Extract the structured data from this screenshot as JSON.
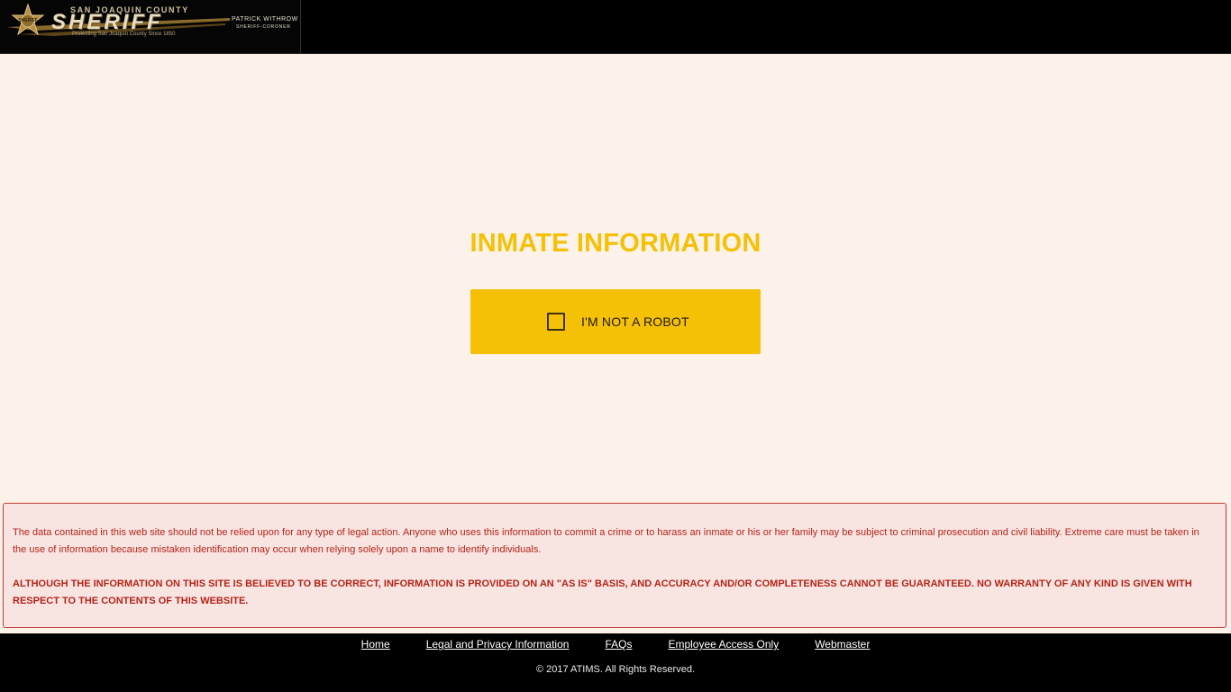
{
  "header": {
    "logo": {
      "county": "SAN JOAQUIN COUNTY",
      "department": "SHERIFF",
      "motto": "Protecting San Joaquin County Since 1850",
      "sheriff_name": "PATRICK WITHROW",
      "sheriff_title": "SHERIFF-CORONER",
      "star_text": "SHERIFF"
    }
  },
  "main": {
    "title": "INMATE INFORMATION",
    "captcha": {
      "label": "I'M NOT A ROBOT",
      "checked": false
    }
  },
  "disclaimer": {
    "paragraph1": "The data contained in this web site should not be relied upon for any type of legal action. Anyone who uses this information to commit a crime or to harass an inmate or his or her family may be subject to criminal prosecution and civil liability. Extreme care must be taken in the use of information because mistaken identification may occur when relying solely upon a name to identify individuals.",
    "paragraph2": "ALTHOUGH THE INFORMATION ON THIS SITE IS BELIEVED TO BE CORRECT, INFORMATION IS PROVIDED ON AN \"AS IS\" BASIS, AND ACCURACY AND/OR COMPLETENESS CANNOT BE GUARANTEED. NO WARRANTY OF ANY KIND IS GIVEN WITH RESPECT TO THE CONTENTS OF THIS WEBSITE."
  },
  "footer": {
    "links": {
      "home": "Home",
      "legal": "Legal and Privacy Information",
      "faqs": "FAQs",
      "employee": "Employee Access Only",
      "webmaster": "Webmaster"
    },
    "copyright": "© 2017 ATIMS. All Rights Reserved."
  },
  "colors": {
    "page_background": "#fdf2e9",
    "accent_yellow": "#f4c107",
    "disclaimer_text": "#b42318",
    "disclaimer_border": "#c23a32",
    "bar_black": "#000000"
  }
}
